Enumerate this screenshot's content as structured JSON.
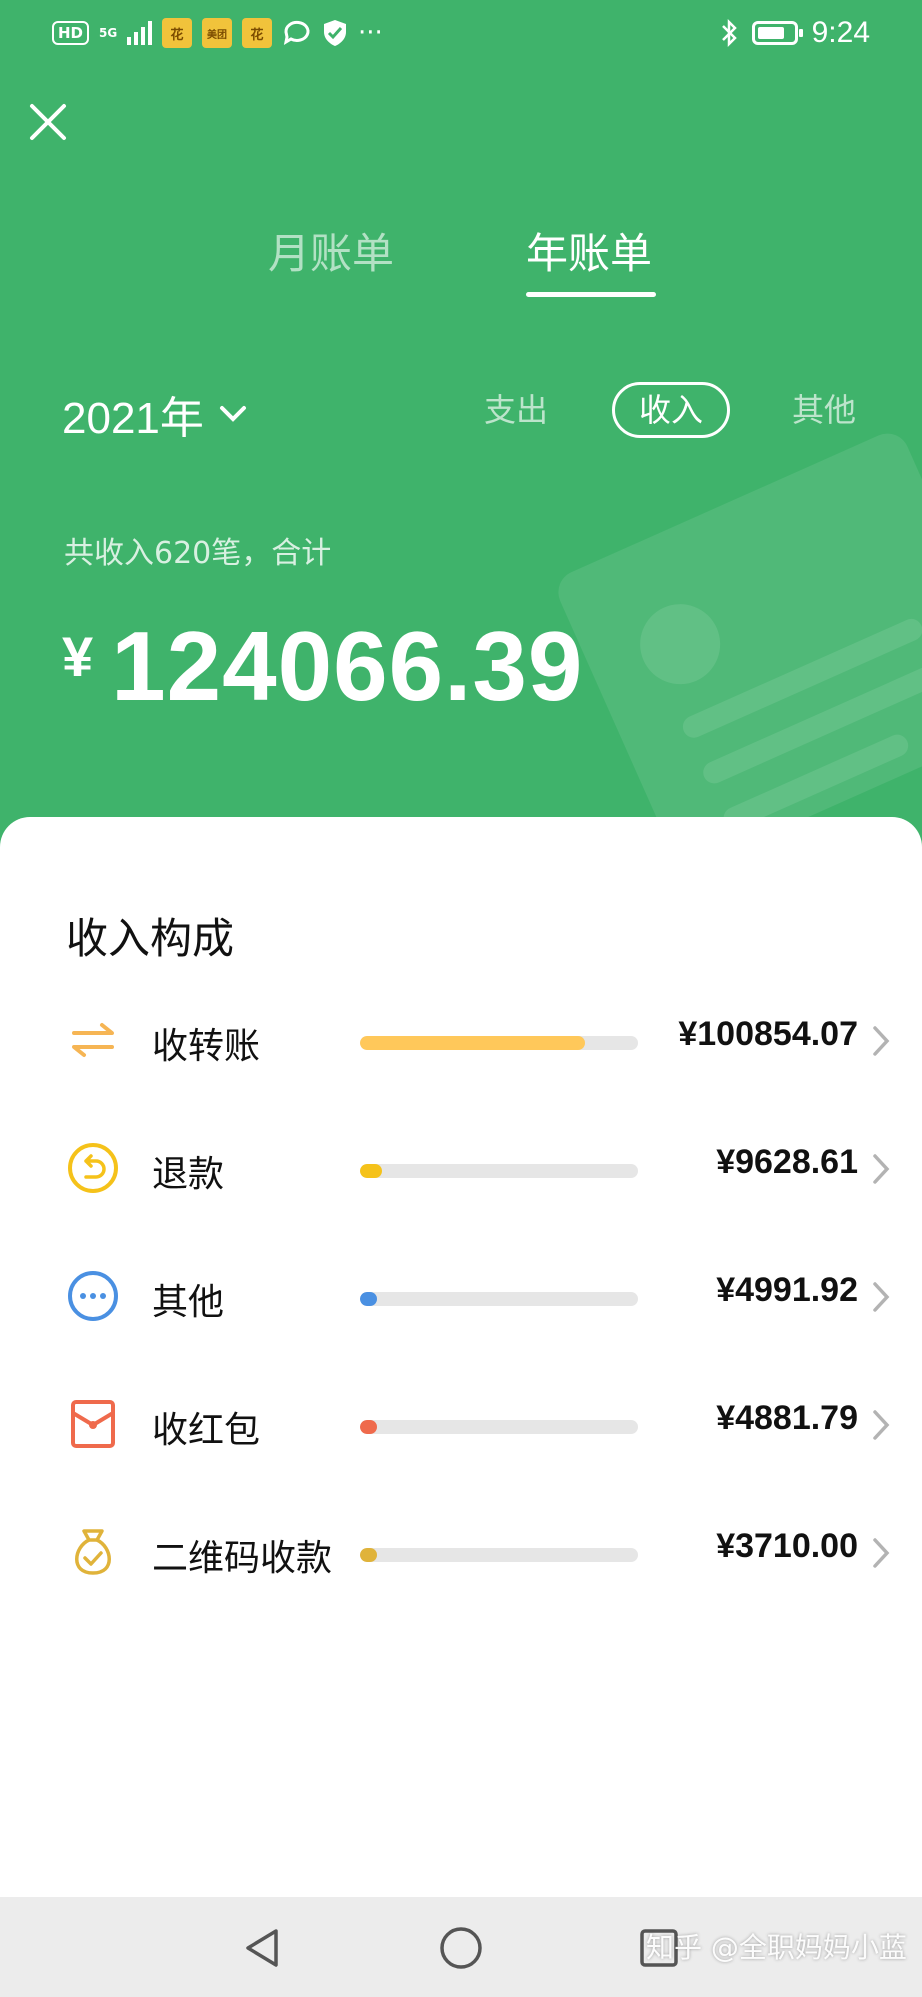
{
  "status_bar": {
    "hd": "HD",
    "network": "5G",
    "time": "9:24",
    "more": "···",
    "app_badge_labels": [
      "花",
      "美团",
      "花"
    ]
  },
  "header": {
    "tabs": [
      {
        "label": "月账单",
        "active": false
      },
      {
        "label": "年账单",
        "active": true
      }
    ],
    "year_label": "2021",
    "year_suffix": "年",
    "filters": [
      {
        "label": "支出",
        "active": false
      },
      {
        "label": "收入",
        "active": true
      },
      {
        "label": "其他",
        "active": false
      }
    ],
    "summary": "共收入620笔，合计",
    "currency": "¥",
    "total": "124066.39"
  },
  "breakdown": {
    "title": "收入构成",
    "items": [
      {
        "label": "收转账",
        "amount": "¥100854.07",
        "fraction": 0.81,
        "color": "#ffc85a",
        "icon": "transfer-icon"
      },
      {
        "label": "退款",
        "amount": "¥9628.61",
        "fraction": 0.08,
        "color": "#f5c21a",
        "icon": "refund-icon"
      },
      {
        "label": "其他",
        "amount": "¥4991.92",
        "fraction": 0.04,
        "color": "#4a90e2",
        "icon": "more-icon"
      },
      {
        "label": "收红包",
        "amount": "¥4881.79",
        "fraction": 0.04,
        "color": "#ef6a4c",
        "icon": "red-packet-icon"
      },
      {
        "label": "二维码收款",
        "amount": "¥3710.00",
        "fraction": 0.03,
        "color": "#e0b33a",
        "icon": "qr-money-bag-icon"
      }
    ]
  },
  "watermark": "知乎 @全职妈妈小蓝",
  "colors": {
    "brand_green": "#3fb36b"
  }
}
